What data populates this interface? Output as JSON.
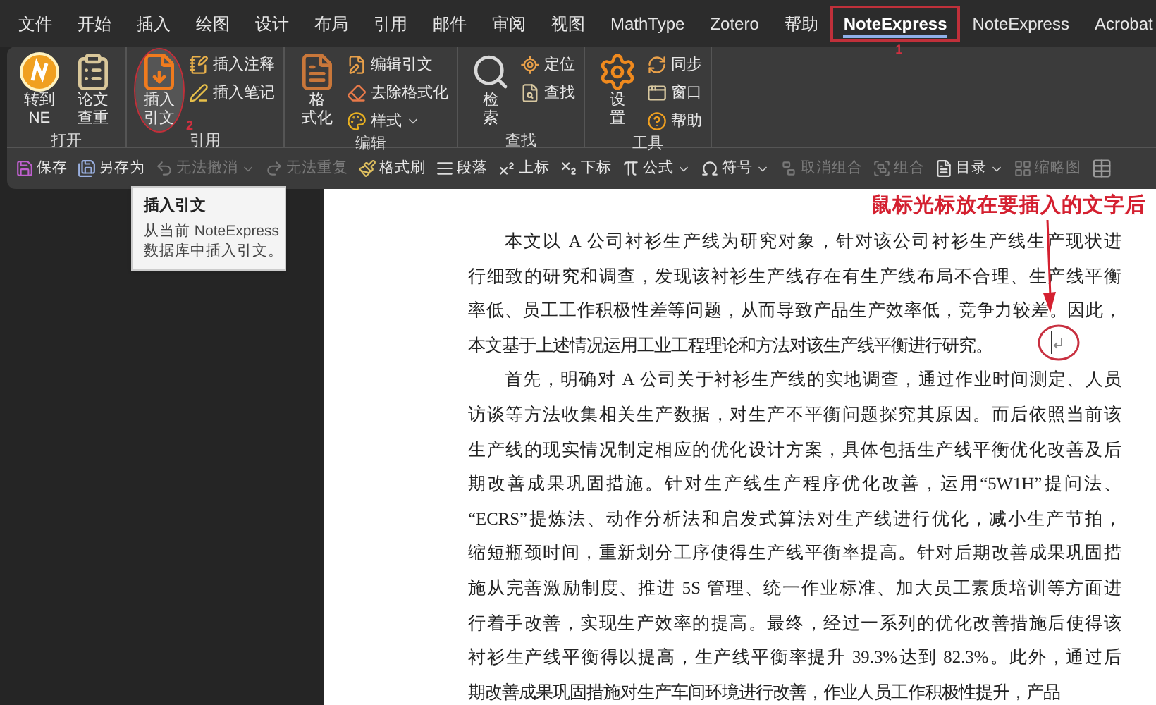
{
  "menu_tabs": [
    {
      "label": "文件",
      "selected": false,
      "annotated": false
    },
    {
      "label": "开始",
      "selected": false,
      "annotated": false
    },
    {
      "label": "插入",
      "selected": false,
      "annotated": false
    },
    {
      "label": "绘图",
      "selected": false,
      "annotated": false
    },
    {
      "label": "设计",
      "selected": false,
      "annotated": false
    },
    {
      "label": "布局",
      "selected": false,
      "annotated": false
    },
    {
      "label": "引用",
      "selected": false,
      "annotated": false
    },
    {
      "label": "邮件",
      "selected": false,
      "annotated": false
    },
    {
      "label": "审阅",
      "selected": false,
      "annotated": false
    },
    {
      "label": "视图",
      "selected": false,
      "annotated": false
    },
    {
      "label": "MathType",
      "selected": false,
      "annotated": false
    },
    {
      "label": "Zotero",
      "selected": false,
      "annotated": false
    },
    {
      "label": "帮助",
      "selected": false,
      "annotated": false
    },
    {
      "label": "NoteExpress",
      "selected": true,
      "annotated": true,
      "step_mark": "1"
    },
    {
      "label": "NoteExpress",
      "selected": false,
      "annotated": false
    },
    {
      "label": "Acrobat",
      "selected": false,
      "annotated": false
    }
  ],
  "ribbon_groups": [
    {
      "label": "打开",
      "large_buttons": [
        {
          "lines": [
            "转到",
            "NE"
          ],
          "highlighted": false,
          "annotated": false
        },
        {
          "lines": [
            "论文",
            "查重"
          ],
          "highlighted": false,
          "annotated": false
        }
      ]
    },
    {
      "label": "引用",
      "large_buttons": [
        {
          "lines": [
            "插入",
            "引文"
          ],
          "highlighted": true,
          "annotated": true,
          "step_mark": "2"
        }
      ],
      "small_buttons": [
        {
          "label": "插入注释",
          "dropdown": false
        },
        {
          "label": "插入笔记",
          "dropdown": false
        }
      ]
    },
    {
      "label": "编辑",
      "large_buttons": [
        {
          "lines": [
            "格",
            "式化"
          ],
          "highlighted": false,
          "annotated": false
        }
      ],
      "small_buttons": [
        {
          "label": "编辑引文",
          "dropdown": false
        },
        {
          "label": "去除格式化",
          "dropdown": false
        },
        {
          "label": "样式",
          "dropdown": true
        }
      ]
    },
    {
      "label": "查找",
      "large_buttons": [
        {
          "lines": [
            "检",
            "索"
          ],
          "highlighted": false,
          "annotated": false
        }
      ],
      "small_buttons": [
        {
          "label": "定位",
          "dropdown": false
        },
        {
          "label": "查找",
          "dropdown": false
        }
      ]
    },
    {
      "label": "工具",
      "large_buttons": [
        {
          "lines": [
            "设",
            "置"
          ],
          "highlighted": false,
          "annotated": false
        }
      ],
      "small_buttons": [
        {
          "label": "同步",
          "dropdown": false
        },
        {
          "label": "窗口",
          "dropdown": false
        },
        {
          "label": "帮助",
          "dropdown": false
        }
      ]
    }
  ],
  "quick_toolbar": [
    {
      "label": "保存",
      "disabled": false,
      "dropdown": false
    },
    {
      "label": "另存为",
      "disabled": false,
      "dropdown": false
    },
    {
      "label": "无法撤消",
      "disabled": true,
      "dropdown": true
    },
    {
      "label": "无法重复",
      "disabled": true,
      "dropdown": false
    },
    {
      "label": "格式刷",
      "disabled": false,
      "dropdown": false
    },
    {
      "label": "段落",
      "disabled": false,
      "dropdown": false
    },
    {
      "label": "上标",
      "disabled": false,
      "dropdown": false
    },
    {
      "label": "下标",
      "disabled": false,
      "dropdown": false
    },
    {
      "label": "公式",
      "disabled": false,
      "dropdown": true
    },
    {
      "label": "符号",
      "disabled": false,
      "dropdown": true
    },
    {
      "label": "取消组合",
      "disabled": true,
      "dropdown": false
    },
    {
      "label": "组合",
      "disabled": true,
      "dropdown": false
    },
    {
      "label": "目录",
      "disabled": false,
      "dropdown": true
    },
    {
      "label": "缩略图",
      "disabled": true,
      "dropdown": false
    }
  ],
  "tooltip": {
    "title": "插入引文",
    "lines": [
      "从当前 NoteExpress",
      "数据库中插入引文。"
    ]
  },
  "annotation": {
    "caption": "鼠标光标放在要插入的文字后"
  },
  "document": {
    "paragraphs": [
      {
        "lines": [
          "本文以 A 公司衬衫生产线为研究对象，针对该公司衬衫生产线生产现状进",
          "行细致的研究和调查，发现该衬衫生产线存在有生产线布局不合理、生产线平衡",
          "率低、员工工作积极性差等问题，从而导致产品生产效率低，竞争力较差。因此，",
          "本文基于上述情况运用工业工程理论和方法对该生产线平衡进行研究。"
        ]
      },
      {
        "lines": [
          "首先，明确对 A 公司关于衬衫生产线的实地调查，通过作业时间测定、人员",
          "访谈等方法收集相关生产数据，对生产不平衡问题探究其原因。而后依照当前该",
          "生产线的现实情况制定相应的优化设计方案，具体包括生产线平衡优化改善及后",
          "期改善成果巩固措施。针对生产线生产程序优化改善，运用“5W1H”提问法、",
          "“ECRS”提炼法、动作分析法和启发式算法对生产线进行优化，减小生产节拍，",
          "缩短瓶颈时间，重新划分工序使得生产线平衡率提高。针对后期改善成果巩固措",
          "施从完善激励制度、推进 5S 管理、统一作业标准、加大员工素质培训等方面进",
          "行着手改善，实现生产效率的提高。最终，经过一系列的优化改善措施后使得该",
          "衬衫生产线平衡得以提高，生产线平衡率提升 39.3%达到 82.3%。此外，通过后",
          "期改善成果巩固措施对生产车间环境进行改善，作业人员工作积极性提升，产品"
        ]
      }
    ]
  }
}
